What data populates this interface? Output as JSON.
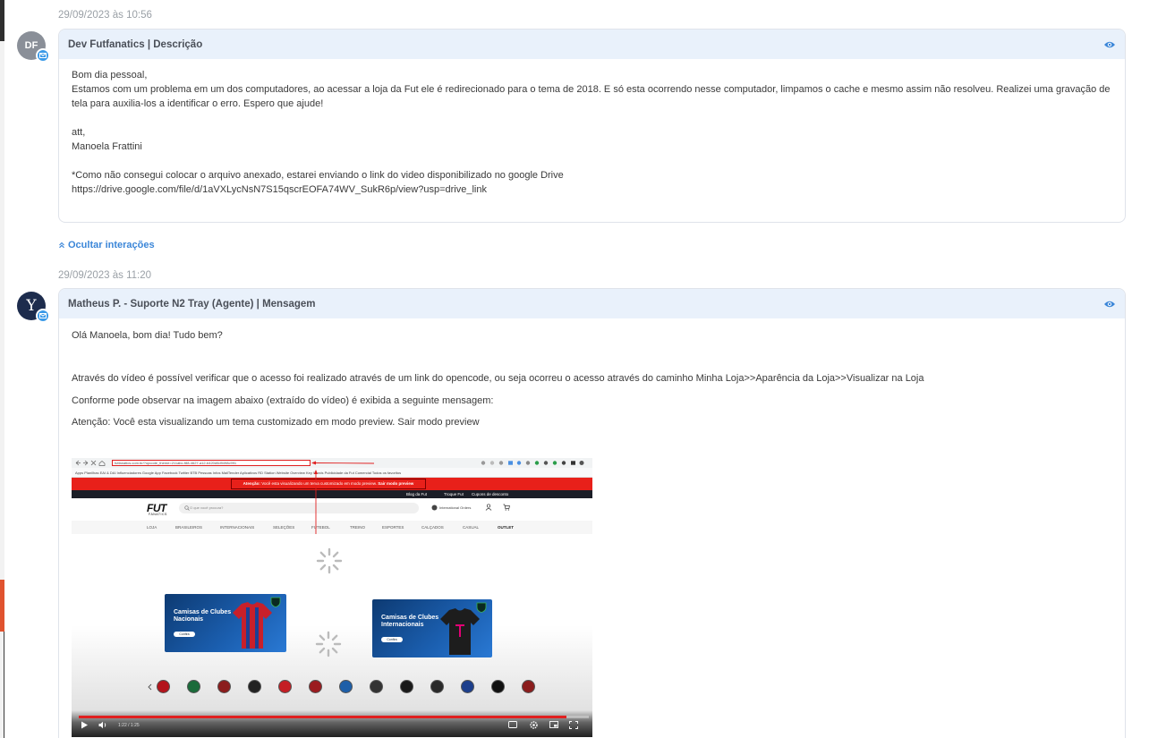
{
  "messages": [
    {
      "timestamp": "29/09/2023 às 10:56",
      "avatar_initials": "DF",
      "title": "Dev Futfanatics | Descrição",
      "body": [
        "Bom dia pessoal,",
        "Estamos com um problema em um dos computadores, ao acessar a loja da Fut ele é redirecionado para o tema de 2018. E só esta ocorrendo nesse computador, limpamos o cache e mesmo assim não resolveu. Realizei uma gravação de tela para auxilia-los a identificar o erro. Espero que ajude!",
        "att,",
        "Manoela Frattini",
        "*Como não consegui colocar o arquivo anexado, estarei enviando o link do video disponibilizado no google Drive",
        "https://drive.google.com/file/d/1aVXLycNsN7S15qscrEOFA74WV_SukR6p/view?usp=drive_link"
      ]
    },
    {
      "timestamp": "29/09/2023 às 11:20",
      "avatar_initials": "Y",
      "title": "Matheus P. - Suporte N2 Tray (Agente) | Mensagem",
      "body": [
        "Olá Manoela, bom dia! Tudo bem?",
        "Através do vídeo é possível verificar que o acesso foi realizado através de um link do opencode, ou seja ocorreu o acesso através do caminho Minha Loja>>Aparência da Loja>>Visualizar na Loja",
        "Conforme pode observar na imagem abaixo (extraído do vídeo)  é exibida a seguinte mensagem:",
        "Atenção: Você esta visualizando um tema customizado em modo preview. Sair modo preview"
      ]
    }
  ],
  "toggle_interactions": "Ocultar interações",
  "video": {
    "url": "futfanatics.com.br/?opcode_theme=211abc-f88-4627-a12-b420d5d9498c991",
    "bookmarks": "Apps   Planilhas   EAI & DAI   Influenciadores   Google   App   Facebook   Twitter   BTB Pessoas   Infos   MailTender   Aplicativos   RD Station   Website Overview   Key Words   Publicidade da Fut   Comercial   Todos os favoritos",
    "alert_prefix": "Atenção:",
    "alert_text": "Você esta visualizando um tema customizado em modo preview.",
    "alert_link": "Sair modo preview",
    "top_links": [
      "Blog da Fut",
      "Troque Fut",
      "Cupons de desconto"
    ],
    "logo": "FUT",
    "logo_sub": "FANATICS",
    "search_placeholder": "O que você procura?",
    "intl_label": "International Orders",
    "nav": [
      "LOJA",
      "BRASILEIROS",
      "INTERNACIONAIS",
      "SELEÇÕES",
      "FUTEBOL",
      "TREINO",
      "ESPORTES",
      "CALÇADOS",
      "CASUAL",
      "OUTLET"
    ],
    "banner_left": "Camisas de Clubes Nacionais",
    "banner_right": "Camisas de Clubes Internacionais",
    "banner_button": "Confira",
    "time": "1:22 / 1:25"
  },
  "colors": {
    "header_bg": "#e9f1fb",
    "accent_blue": "#3b86d8",
    "badge_blue": "#3b9ae8",
    "alert_red": "#e8201a"
  }
}
